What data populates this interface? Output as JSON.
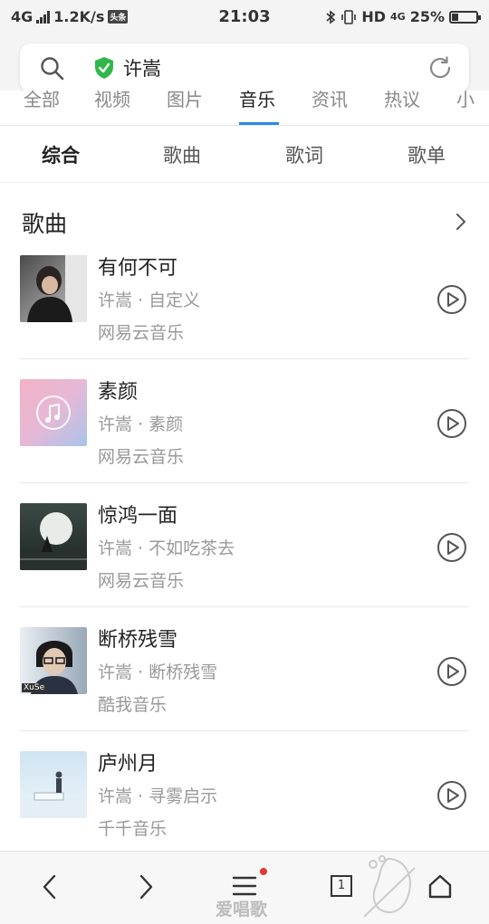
{
  "status_bar": {
    "network_type": "4G",
    "speed": "1.2K/s",
    "badge": "头条",
    "time": "21:03",
    "hd_label": "HD",
    "network2": "4G",
    "battery": "25%",
    "battery_level": 0.25
  },
  "search": {
    "query": "许嵩"
  },
  "categories": [
    "全部",
    "视频",
    "图片",
    "音乐",
    "资讯",
    "热议",
    "小"
  ],
  "active_category": "音乐",
  "subtabs": [
    "综合",
    "歌曲",
    "歌词",
    "歌单"
  ],
  "active_subtab": "综合",
  "section": {
    "title": "歌曲"
  },
  "songs": [
    {
      "title": "有何不可",
      "meta": "许嵩 · 自定义",
      "source": "网易云音乐",
      "cover": "portrait-dark"
    },
    {
      "title": "素颜",
      "meta": "许嵩 · 素颜",
      "source": "网易云音乐",
      "cover": "music-note-pink"
    },
    {
      "title": "惊鸿一面",
      "meta": "许嵩 · 不如吃茶去",
      "source": "网易云音乐",
      "cover": "moon-night"
    },
    {
      "title": "断桥残雪",
      "meta": "许嵩 · 断桥残雪",
      "source": "酷我音乐",
      "cover": "portrait-glasses"
    },
    {
      "title": "庐州月",
      "meta": "许嵩 · 寻雾启示",
      "source": "千千音乐",
      "cover": "piano-sky"
    }
  ],
  "cover_badge": "XuSe",
  "navbar": {
    "tab_count": "1"
  },
  "watermark": "爱唱歌",
  "colors": {
    "accent": "#2a89e6",
    "shield": "#2fb84a",
    "notification_dot": "#e8352e"
  }
}
